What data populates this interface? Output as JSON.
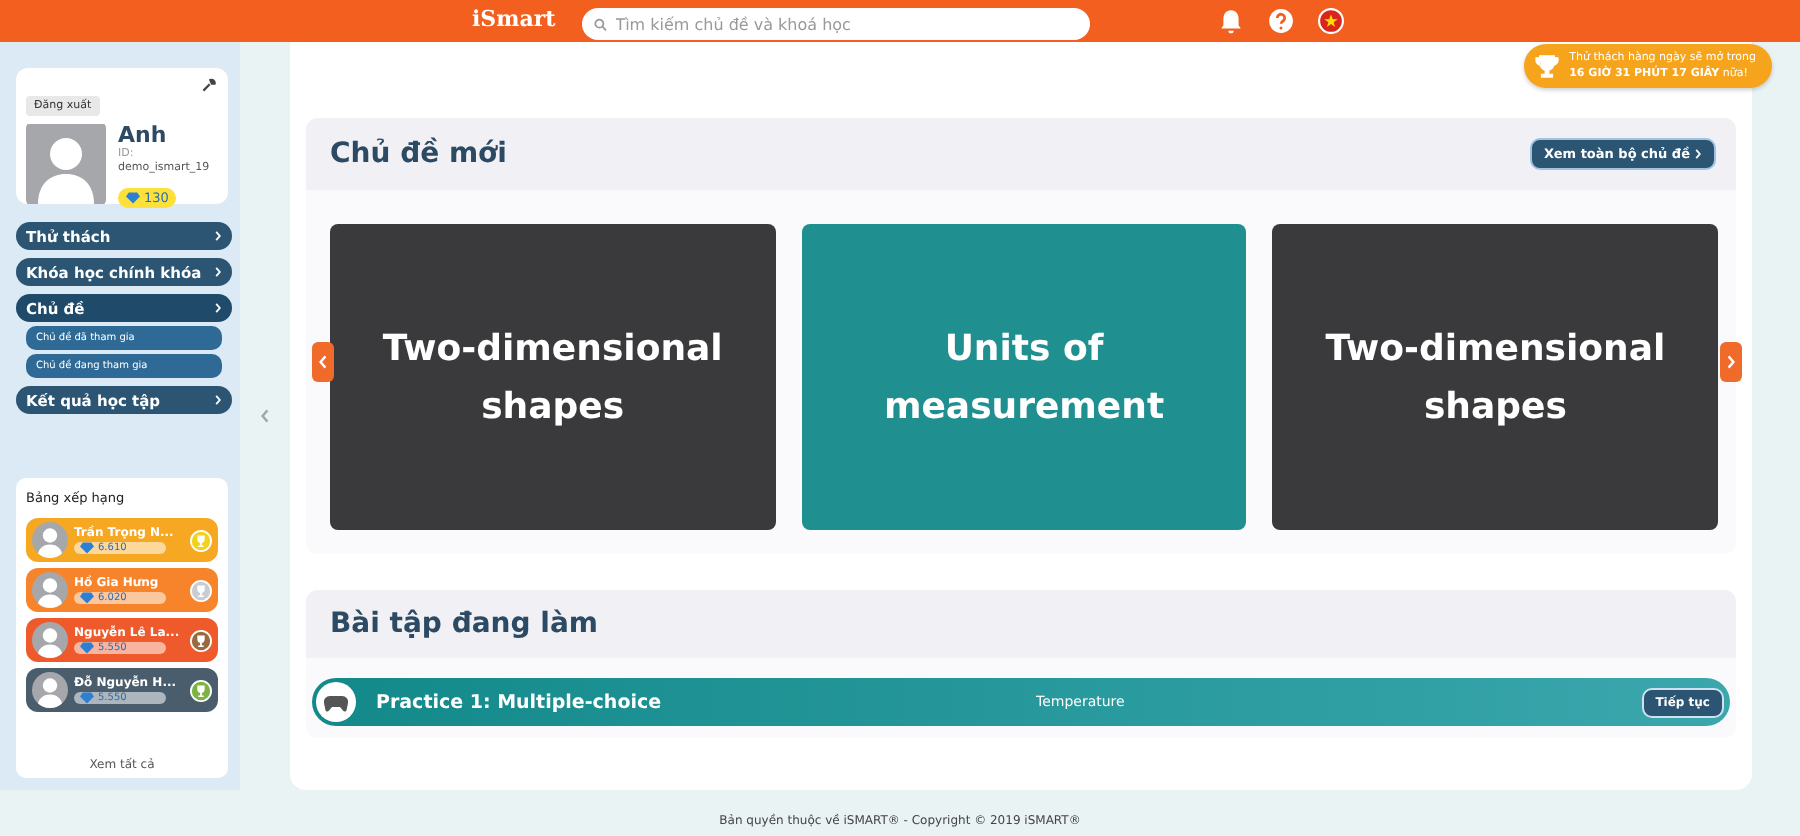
{
  "header": {
    "logo": "iSmart",
    "search": {
      "placeholder": "Tìm kiếm chủ đề và khoá học"
    }
  },
  "challenge_banner": {
    "line_1": "Thử thách hàng ngày sẽ mở trong",
    "countdown": "16 GIỜ 31 PHÚT 17 GIÂY",
    "suffix": "nữa!"
  },
  "profile": {
    "logout": "Đăng xuất",
    "name": "Anh",
    "id_label": "ID:",
    "id": "demo_ismart_19",
    "gems": "130"
  },
  "menu": [
    {
      "label": "Thử thách",
      "expanded": false
    },
    {
      "label": "Khóa học chính khóa",
      "expanded": false
    },
    {
      "label": "Chủ đề",
      "expanded": true,
      "children": [
        {
          "label": "Chủ đề đã tham gia"
        },
        {
          "label": "Chủ đề đang tham gia"
        }
      ]
    },
    {
      "label": "Kết quả học tập",
      "expanded": false
    }
  ],
  "leaderboard": {
    "title": "Bảng xếp hạng",
    "entries": [
      {
        "name": "Trần Trọng N...",
        "score": "6.610",
        "color": "#f7a823",
        "trophy": {
          "color": "#f2d21b"
        }
      },
      {
        "name": "Hồ Gia Hưng",
        "score": "6.020",
        "color": "#f7842a",
        "trophy": {
          "color": "#c9ccd1"
        }
      },
      {
        "name": "Nguyễn Lê La...",
        "score": "5.550",
        "color": "#ee5a2c",
        "trophy": {
          "color": "#9a6a3e"
        }
      },
      {
        "name": "Đỗ Nguyễn H...",
        "score": "5.550",
        "color": "#4a5d6c",
        "trophy": {
          "color": "#7cb342"
        }
      }
    ],
    "see_all": "Xem tất cả"
  },
  "new_topics": {
    "title": "Chủ đề mới",
    "see_all": "Xem toàn bộ chủ đề",
    "topics": [
      {
        "title": "Two-dimensional shapes",
        "kind": "geometry"
      },
      {
        "title": "Units of measurement",
        "kind": "measurement"
      },
      {
        "title": "Two-dimensional shapes",
        "kind": "geometry"
      }
    ]
  },
  "in_progress": {
    "title": "Bài tập đang làm",
    "items": [
      {
        "title": "Practice 1: Multiple-choice",
        "topic": "Temperature",
        "action": "Tiếp tục"
      }
    ]
  },
  "footer": "Bản quyền thuộc về iSMART® - Copyright © 2019 iSMART®"
}
